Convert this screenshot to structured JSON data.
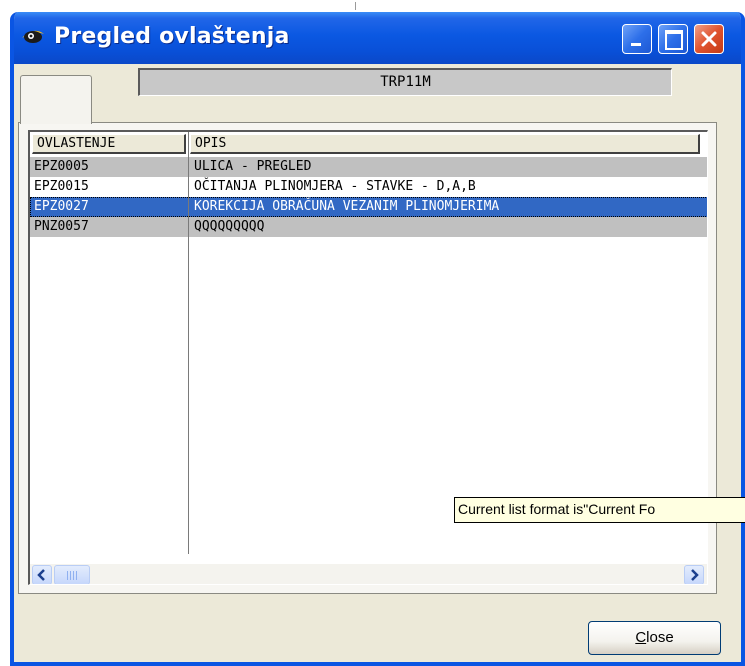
{
  "window": {
    "title": "Pregled ovlaštenja",
    "icon": "app-eye-icon",
    "controls": [
      "minimize-icon",
      "maximize-icon",
      "close-icon"
    ]
  },
  "header_field": {
    "value": "TRP11M"
  },
  "list": {
    "columns": [
      "OVLASTENJE",
      "OPIS"
    ],
    "rows": [
      {
        "code": "EPZ0005",
        "desc": "ULICA - PREGLED",
        "style": "grey"
      },
      {
        "code": "EPZ0015",
        "desc": "OČITANJA PLINOMJERA - STAVKE - D,A,B",
        "style": "white"
      },
      {
        "code": "EPZ0027",
        "desc": "KOREKCIJA OBRAČUNA VEZANIM PLINOMJERIMA",
        "style": "selected"
      },
      {
        "code": "PNZ0057",
        "desc": "QQQQQQQQQ",
        "style": "grey"
      }
    ]
  },
  "tooltip": {
    "text": "Current list format is\"Current Fo"
  },
  "close_button": {
    "accel": "C",
    "rest": "lose"
  },
  "colors": {
    "titlebar": "#0b58e2",
    "selection": "#3168c4",
    "row_grey": "#c0c0c0",
    "tooltip_bg": "#ffffe1"
  }
}
